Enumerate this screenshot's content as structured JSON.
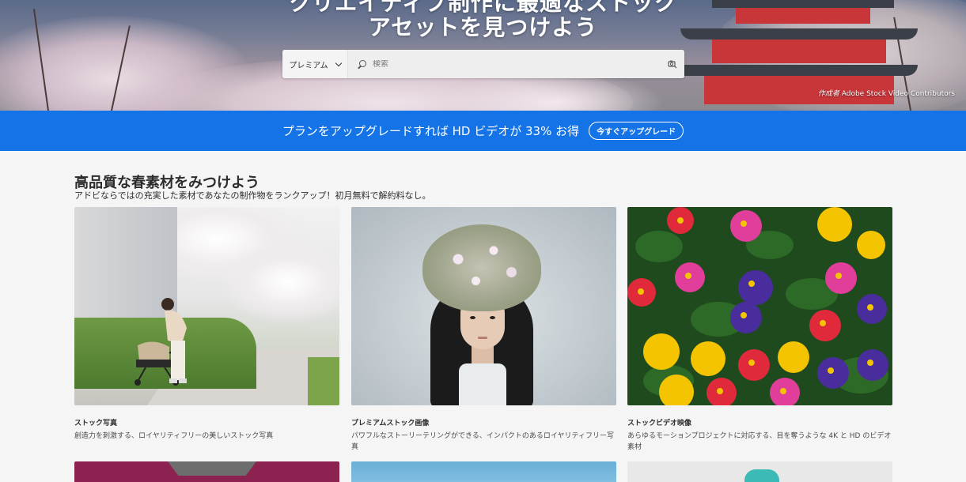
{
  "hero": {
    "title_line1": "クリエイティブ制作に最適なストック",
    "title_line2": "アセットを見つけよう",
    "search": {
      "dropdown_label": "プレミアム",
      "placeholder": "検索",
      "value": ""
    },
    "credit_prefix": "作成者",
    "credit_name": "Adobe Stock Video Contributors"
  },
  "banner": {
    "message": "プランをアップグレードすれば HD ビデオが 33% お得",
    "button_label": "今すぐアップグレード"
  },
  "section": {
    "heading": "高品質な春素材をみつけよう",
    "subheading": "アドビならではの充実した素材であなたの制作物をランクアップ！初月無料で解約料なし。"
  },
  "cards": [
    {
      "title": "ストック写真",
      "description": "創造力を刺激する、ロイヤリティフリーの美しいストック写真"
    },
    {
      "title": "プレミアムストック画像",
      "description": "パワフルなストーリーテリングができる、インパクトのあるロイヤリティフリー写真"
    },
    {
      "title": "ストックビデオ映像",
      "description": "あらゆるモーションプロジェクトに対応する、目を奪うような 4K と HD のビデオ素材"
    }
  ],
  "colors": {
    "banner_blue": "#1473e6",
    "page_bg": "#f5f5f5"
  },
  "icons": {
    "dropdown": "chevron-down-icon",
    "search": "search-icon",
    "visual_search": "camera-search-icon"
  }
}
